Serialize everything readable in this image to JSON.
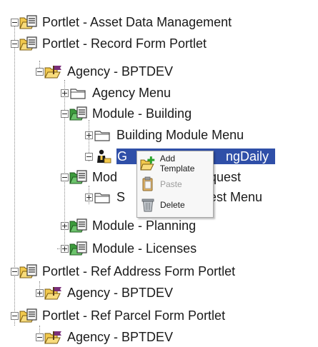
{
  "tree": {
    "nodes": [
      {
        "label": "Portlet - Asset Data Management",
        "icon": "portlet-icon"
      },
      {
        "label": "Portlet - Record Form Portlet",
        "icon": "portlet-icon"
      },
      {
        "label": "Agency - BPTDEV",
        "icon": "agency-folder-icon"
      },
      {
        "label": "Agency Menu",
        "icon": "folder-icon"
      },
      {
        "label": "Module - Building",
        "icon": "module-icon"
      },
      {
        "label": "Building Module Menu",
        "icon": "folder-icon"
      },
      {
        "label": "GeneratingDaily",
        "display": "G",
        "display_tail": "ngDaily",
        "icon": "user-icon",
        "selected": true
      },
      {
        "label": "Module - Service Request",
        "display": "Mod",
        "display_tail": "Request",
        "icon": "module-icon"
      },
      {
        "label": "Service Request Menu",
        "display": "S",
        "display_tail": "est Menu",
        "icon": "folder-icon"
      },
      {
        "label": "Module - Planning",
        "icon": "module-icon"
      },
      {
        "label": "Module - Licenses",
        "icon": "module-icon"
      },
      {
        "label": "Portlet - Ref Address Form Portlet",
        "icon": "portlet-icon"
      },
      {
        "label": "Agency - BPTDEV",
        "icon": "agency-folder-icon"
      },
      {
        "label": "Portlet - Ref Parcel Form Portlet",
        "icon": "portlet-icon"
      },
      {
        "label": "Agency - BPTDEV",
        "icon": "agency-folder-icon"
      }
    ]
  },
  "context_menu": {
    "items": [
      {
        "label": "Add Template",
        "icon": "add-template-icon",
        "enabled": true
      },
      {
        "label": "Paste",
        "icon": "paste-icon",
        "enabled": false
      },
      {
        "label": "Delete",
        "icon": "trash-icon",
        "enabled": true
      }
    ]
  },
  "colors": {
    "selection": "#2f4fa8",
    "folder": "#f2c94c",
    "module_green": "#3c9a3c"
  }
}
